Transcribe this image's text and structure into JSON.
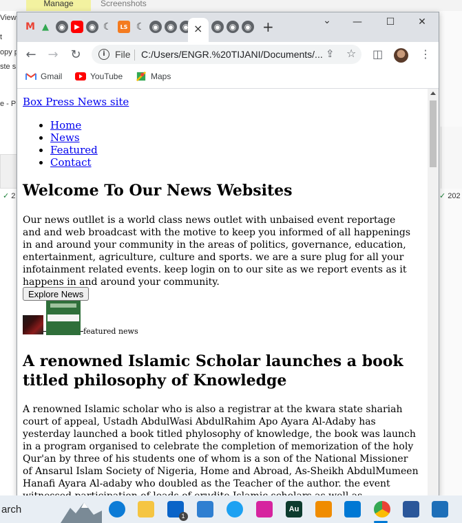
{
  "background": {
    "ribbon_manage": "Manage",
    "ribbon_screenshots": "Screenshots",
    "left_texts": [
      "View",
      "t",
      "opy p",
      "ste s",
      "e - P"
    ],
    "thumb_check_left": "2",
    "thumb_check_right": "202"
  },
  "browser": {
    "tabs": [
      {
        "icon": "gmail-icon",
        "color": "#ea4335"
      },
      {
        "icon": "google-drive-icon",
        "color": "#34a853"
      },
      {
        "icon": "globe-icon",
        "color": "#5f6368"
      },
      {
        "icon": "youtube-icon",
        "color": "#ff0000"
      },
      {
        "icon": "globe-icon",
        "color": "#5f6368"
      },
      {
        "icon": "crescent-icon",
        "color": "#333333"
      },
      {
        "icon": "ls-icon",
        "color": "#f47b20"
      },
      {
        "icon": "crescent-icon",
        "color": "#333333"
      },
      {
        "icon": "globe-icon",
        "color": "#5f6368"
      },
      {
        "icon": "globe-icon",
        "color": "#5f6368"
      },
      {
        "icon": "globe-icon",
        "color": "#5f6368"
      }
    ],
    "active_tab_close": "×",
    "tabs_after": [
      {
        "icon": "globe-icon"
      },
      {
        "icon": "globe-icon"
      },
      {
        "icon": "globe-icon"
      }
    ],
    "new_tab": "+",
    "window": {
      "dropdown": "⌄",
      "minimize": "—",
      "maximize": "☐",
      "close": "✕"
    },
    "url_scheme_label": "File",
    "url": "C:/Users/ENGR.%20TIJANI/Documents/...",
    "bookmarks": [
      {
        "label": "Gmail",
        "icon": "gmail-icon"
      },
      {
        "label": "YouTube",
        "icon": "youtube-icon"
      },
      {
        "label": "Maps",
        "icon": "maps-icon"
      }
    ]
  },
  "page": {
    "site_link": "Box Press News site",
    "nav": [
      "Home",
      "News",
      "Featured",
      "Contact"
    ],
    "welcome_heading": "Welcome To Our News Websites",
    "intro": "Our news outllet is a world class news outlet with unbaised event reportage and and web broadcast with the motive to keep you informed of all happenings in and around your community in the areas of politics, governance, education, entertainment, agriculture, culture and sports. we are a sure plug for all your infotainment related events. keep login on to our site as we report events as it happens in and around your community.",
    "explore_button": "Explore News",
    "featured_caption": "featured news",
    "article_heading": "A renowned Islamic Scholar launches a book titled philosophy of Knowledge",
    "article_body": "A renowned Islamic scholar who is also a registrar at the kwara state shariah court of appeal, Ustadh AbdulWasi AbdulRahim Apo Ayara Al-Adaby has yesterday launched a book titled phylosophy of knowledge, the book was launch in a program organised to celebrate the completion of memorization of the holy Qur'an by three of his students one of whom is a son of the National Missioner of Ansarul Islam Society of Nigeria, Home and Abroad, As-Sheikh AbdulMumeen Hanafi Ayara Al-adaby who doubled as the Teacher of the author. the event witnessed participation of loads of erudite Islamic scholars as well as philantropists, a lecture was delivered by the Grand Kadi of the kwara"
  },
  "taskbar": {
    "search_text": "arch",
    "apps": [
      {
        "name": "edge-icon",
        "color": "#0c7bd6"
      },
      {
        "name": "file-explorer-icon",
        "color": "#f5c542"
      },
      {
        "name": "mail-icon",
        "color": "#0a64c8",
        "badge": "1"
      },
      {
        "name": "store-icon",
        "color": "#2f7fd1"
      },
      {
        "name": "twitter-icon",
        "color": "#1da1f2"
      },
      {
        "name": "instagram-icon",
        "color": "#d6249f"
      },
      {
        "name": "audition-icon",
        "color": "#0d3b2e",
        "label": "Au"
      },
      {
        "name": "vlc-icon",
        "color": "#f08c00"
      },
      {
        "name": "vscode-icon",
        "color": "#0078d4"
      },
      {
        "name": "chrome-icon",
        "color": "#4285f4"
      },
      {
        "name": "word-icon",
        "color": "#2b579a"
      },
      {
        "name": "photos-icon",
        "color": "#1e6fb8"
      }
    ]
  }
}
